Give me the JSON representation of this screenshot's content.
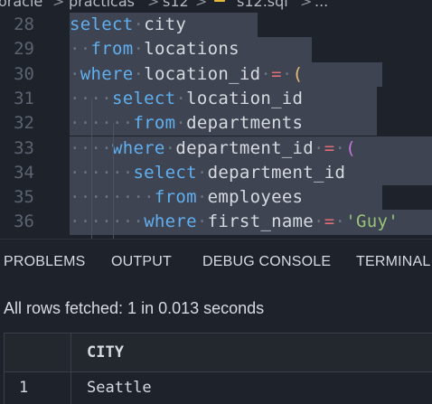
{
  "breadcrumb": {
    "items": [
      "oracle",
      "practicas",
      "s12",
      "s12.sql",
      "..."
    ],
    "separator": ">",
    "file_icon": "database-icon",
    "file_icon_color": "#e5b93a"
  },
  "editor": {
    "line_numbers": [
      "28",
      "29",
      "30",
      "31",
      "32",
      "33",
      "34",
      "35",
      "36"
    ],
    "lines": [
      [
        {
          "t": "kw",
          "v": "select"
        },
        {
          "t": "dot",
          "v": "·"
        },
        {
          "t": "id",
          "v": "city"
        }
      ],
      [
        {
          "t": "kw",
          "v": "from"
        },
        {
          "t": "dot",
          "v": "·"
        },
        {
          "t": "id",
          "v": "locations"
        }
      ],
      [
        {
          "t": "kw",
          "v": "where"
        },
        {
          "t": "dot",
          "v": "·"
        },
        {
          "t": "id",
          "v": "location_id"
        },
        {
          "t": "dot",
          "v": "·"
        },
        {
          "t": "op",
          "v": "="
        },
        {
          "t": "dot",
          "v": "·"
        },
        {
          "t": "py",
          "v": "("
        }
      ],
      [
        {
          "t": "kw",
          "v": "select"
        },
        {
          "t": "dot",
          "v": "·"
        },
        {
          "t": "id",
          "v": "location_id"
        }
      ],
      [
        {
          "t": "kw",
          "v": "from"
        },
        {
          "t": "dot",
          "v": "·"
        },
        {
          "t": "id",
          "v": "departments"
        }
      ],
      [
        {
          "t": "kw",
          "v": "where"
        },
        {
          "t": "dot",
          "v": "·"
        },
        {
          "t": "id",
          "v": "department_id"
        },
        {
          "t": "dot",
          "v": "·"
        },
        {
          "t": "op",
          "v": "="
        },
        {
          "t": "dot",
          "v": "·"
        },
        {
          "t": "pp",
          "v": "("
        }
      ],
      [
        {
          "t": "kw",
          "v": "select"
        },
        {
          "t": "dot",
          "v": "·"
        },
        {
          "t": "id",
          "v": "department_id"
        }
      ],
      [
        {
          "t": "kw",
          "v": "from"
        },
        {
          "t": "dot",
          "v": "·"
        },
        {
          "t": "id",
          "v": "employees"
        }
      ],
      [
        {
          "t": "kw",
          "v": "where"
        },
        {
          "t": "dot",
          "v": "·"
        },
        {
          "t": "id",
          "v": "first_name"
        },
        {
          "t": "dot",
          "v": "·"
        },
        {
          "t": "op",
          "v": "="
        },
        {
          "t": "dot",
          "v": "·"
        },
        {
          "t": "str",
          "v": "'Guy'"
        }
      ]
    ],
    "indent_dots": [
      "",
      "··",
      "·",
      "····",
      "······",
      "····",
      "······",
      "········",
      "·······"
    ],
    "colors": {
      "keyword": "#61afef",
      "operator": "#e06c75",
      "string": "#98c379",
      "selection": "#3e4451"
    }
  },
  "panel": {
    "tabs": [
      "PROBLEMS",
      "OUTPUT",
      "DEBUG CONSOLE",
      "TERMINAL"
    ],
    "status": "All rows fetched: 1 in 0.013 seconds",
    "results": {
      "columns": [
        "CITY"
      ],
      "rows": [
        {
          "num": "1",
          "cells": [
            "Seattle"
          ]
        }
      ]
    }
  }
}
